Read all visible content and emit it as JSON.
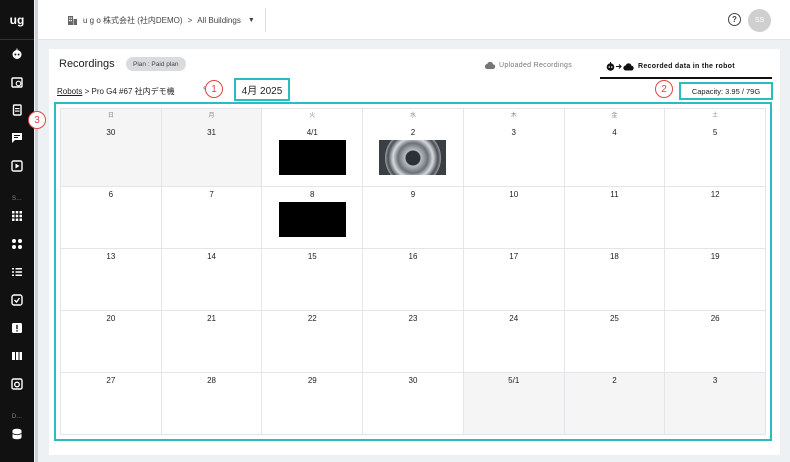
{
  "sidebar": {
    "logo": "ug",
    "items": [
      {
        "name": "robot-icon"
      },
      {
        "name": "schedule-icon"
      },
      {
        "name": "recordings-icon"
      },
      {
        "name": "chat-icon"
      },
      {
        "name": "play-icon"
      }
    ],
    "section_label_1": "S…",
    "items2": [
      {
        "name": "grid-icon"
      },
      {
        "name": "flow-icon"
      },
      {
        "name": "checklist-icon"
      },
      {
        "name": "task-icon"
      },
      {
        "name": "alert-icon"
      },
      {
        "name": "map-icon"
      },
      {
        "name": "camera-icon"
      }
    ],
    "section_label_2": "D…",
    "items3": [
      {
        "name": "database-icon"
      }
    ]
  },
  "topbar": {
    "org": "u g o 株式会社 (社内DEMO)",
    "separator": ">",
    "building": "All Buildings",
    "help": "?",
    "avatar": "SS"
  },
  "page": {
    "title": "Recordings",
    "plan": "Plan : Paid plan",
    "tab_uploaded": "Uploaded Recordings",
    "tab_recorded": "Recorded data in the robot",
    "crumb_link": "Robots",
    "crumb_rest": " > Pro G4 #67 社内デモ機",
    "prev": "‹",
    "month": "4月 2025",
    "capacity": "Capacity: 3.95 / 79G",
    "badge1": "1",
    "badge2": "2",
    "badge3": "3"
  },
  "weekdays": [
    "日",
    "月",
    "火",
    "水",
    "木",
    "金",
    "土"
  ],
  "weeks": [
    [
      {
        "d": "30",
        "out": true
      },
      {
        "d": "31",
        "out": true
      },
      {
        "d": "4/1",
        "thumb": "black"
      },
      {
        "d": "2",
        "thumb": "image"
      },
      {
        "d": "3"
      },
      {
        "d": "4"
      },
      {
        "d": "5"
      }
    ],
    [
      {
        "d": "6"
      },
      {
        "d": "7"
      },
      {
        "d": "8",
        "thumb": "black"
      },
      {
        "d": "9"
      },
      {
        "d": "10"
      },
      {
        "d": "11"
      },
      {
        "d": "12"
      }
    ],
    [
      {
        "d": "13"
      },
      {
        "d": "14"
      },
      {
        "d": "15"
      },
      {
        "d": "16"
      },
      {
        "d": "17"
      },
      {
        "d": "18"
      },
      {
        "d": "19"
      }
    ],
    [
      {
        "d": "20"
      },
      {
        "d": "21"
      },
      {
        "d": "22"
      },
      {
        "d": "23"
      },
      {
        "d": "24"
      },
      {
        "d": "25"
      },
      {
        "d": "26"
      }
    ],
    [
      {
        "d": "27"
      },
      {
        "d": "28"
      },
      {
        "d": "29"
      },
      {
        "d": "30"
      },
      {
        "d": "5/1",
        "out": true
      },
      {
        "d": "2",
        "out": true
      },
      {
        "d": "3",
        "out": true
      }
    ]
  ],
  "colors": {
    "highlight": "#2bbcc0",
    "annotation": "#e04545",
    "sidebar": "#111111"
  }
}
